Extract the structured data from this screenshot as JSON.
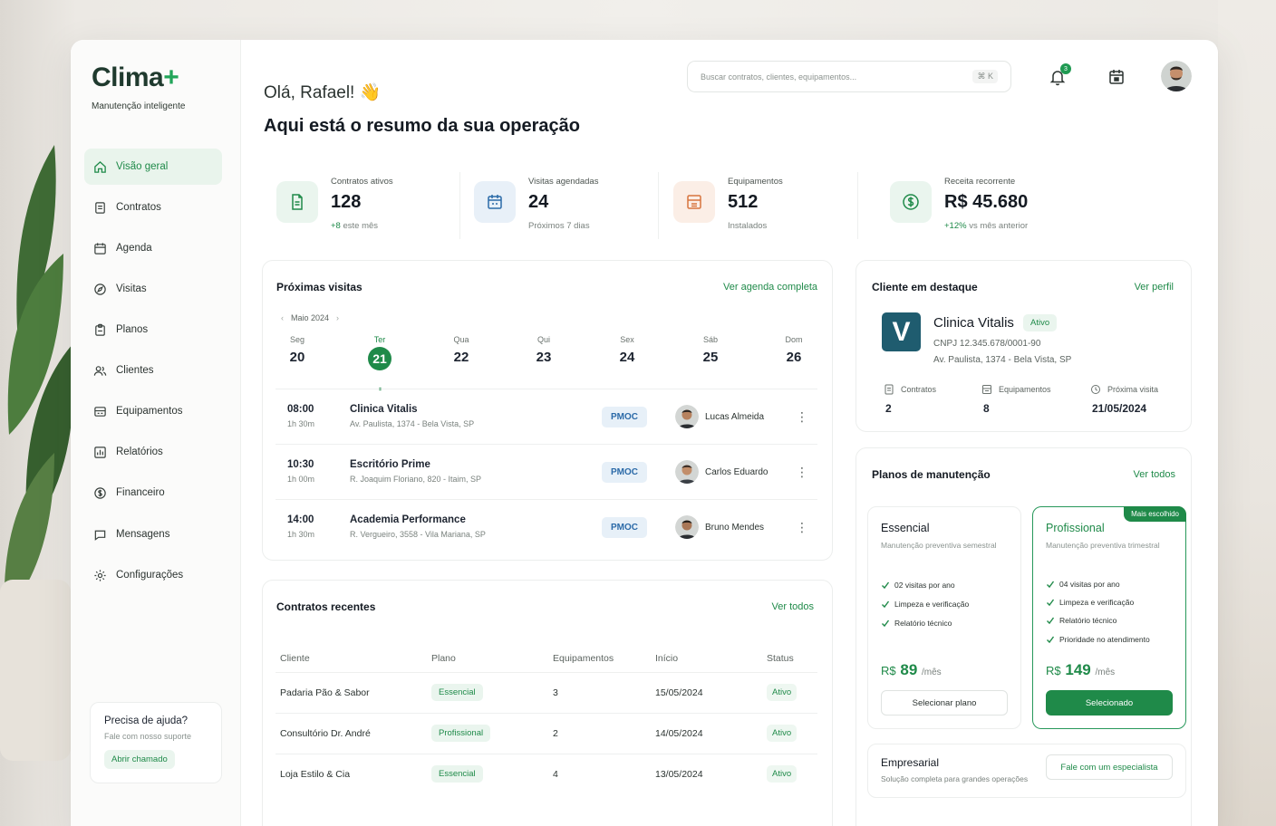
{
  "brand": {
    "name": "Clima",
    "plus": "+",
    "tagline": "Manutenção inteligente"
  },
  "sidebar": {
    "items": [
      {
        "label": "Visão geral",
        "icon": "home-icon",
        "active": true
      },
      {
        "label": "Contratos",
        "icon": "document-icon"
      },
      {
        "label": "Agenda",
        "icon": "calendar-icon"
      },
      {
        "label": "Visitas",
        "icon": "compass-icon"
      },
      {
        "label": "Planos",
        "icon": "clipboard-icon"
      },
      {
        "label": "Clientes",
        "icon": "users-icon"
      },
      {
        "label": "Equipamentos",
        "icon": "equipment-icon"
      },
      {
        "label": "Relatórios",
        "icon": "report-icon"
      },
      {
        "label": "Financeiro",
        "icon": "dollar-icon"
      },
      {
        "label": "Mensagens",
        "icon": "message-icon"
      },
      {
        "label": "Configurações",
        "icon": "gear-icon"
      }
    ],
    "help": {
      "title": "Precisa de ajuda?",
      "subtitle": "Fale com nosso suporte",
      "button": "Abrir chamado"
    }
  },
  "header": {
    "greeting": "Olá, Rafael! 👋",
    "subtitle": "Aqui está o resumo da sua operação",
    "search_placeholder": "Buscar contratos, clientes, equipamentos...",
    "search_shortcut": "⌘ K",
    "notifications": "3"
  },
  "stats": [
    {
      "label": "Contratos ativos",
      "value": "128",
      "sub_highlight": "+8",
      "sub": " este mês"
    },
    {
      "label": "Visitas agendadas",
      "value": "24",
      "sub_highlight": "",
      "sub": "Próximos 7 dias"
    },
    {
      "label": "Equipamentos",
      "value": "512",
      "sub_highlight": "",
      "sub": "Instalados"
    },
    {
      "label": "Receita recorrente",
      "value": "R$ 45.680",
      "sub_highlight": "+12%",
      "sub": " vs mês anterior"
    }
  ],
  "visits": {
    "title": "Próximas visitas",
    "link": "Ver agenda completa",
    "month": "Maio 2024",
    "days": [
      {
        "wd": "Seg",
        "dn": "20"
      },
      {
        "wd": "Ter",
        "dn": "21",
        "today": true
      },
      {
        "wd": "Qua",
        "dn": "22"
      },
      {
        "wd": "Qui",
        "dn": "23"
      },
      {
        "wd": "Sex",
        "dn": "24"
      },
      {
        "wd": "Sáb",
        "dn": "25"
      },
      {
        "wd": "Dom",
        "dn": "26"
      }
    ],
    "rows": [
      {
        "time": "08:00",
        "dur": "1h 30m",
        "client": "Clinica Vitalis",
        "addr": "Av. Paulista, 1374 - Bela Vista, SP",
        "tag": "PMOC",
        "tech": "Lucas Almeida"
      },
      {
        "time": "10:30",
        "dur": "1h 00m",
        "client": "Escritório Prime",
        "addr": "R. Joaquim Floriano, 820 - Itaim, SP",
        "tag": "PMOC",
        "tech": "Carlos Eduardo"
      },
      {
        "time": "14:00",
        "dur": "1h 30m",
        "client": "Academia Performance",
        "addr": "R. Vergueiro, 3558 - Vila Mariana, SP",
        "tag": "PMOC",
        "tech": "Bruno Mendes"
      }
    ]
  },
  "contracts": {
    "title": "Contratos recentes",
    "link": "Ver todos",
    "headers": [
      "Cliente",
      "Plano",
      "Equipamentos",
      "Início",
      "Status"
    ],
    "rows": [
      {
        "client": "Padaria Pão & Sabor",
        "plan": "Essencial",
        "equip": "3",
        "start": "15/05/2024",
        "status": "Ativo"
      },
      {
        "client": "Consultório Dr. André",
        "plan": "Profissional",
        "equip": "2",
        "start": "14/05/2024",
        "status": "Ativo"
      },
      {
        "client": "Loja Estilo & Cia",
        "plan": "Essencial",
        "equip": "4",
        "start": "13/05/2024",
        "status": "Ativo"
      }
    ]
  },
  "featured": {
    "title": "Cliente em destaque",
    "link": "Ver perfil",
    "logo_letter": "V",
    "name": "Clinica Vitalis",
    "badge": "Ativo",
    "cnpj": "CNPJ 12.345.678/0001-90",
    "addr": "Av. Paulista, 1374 - Bela Vista, SP",
    "stats": [
      {
        "label": "Contratos",
        "value": "2"
      },
      {
        "label": "Equipamentos",
        "value": "8"
      },
      {
        "label": "Próxima visita",
        "value": "21/05/2024"
      }
    ]
  },
  "plans": {
    "title": "Planos de manutenção",
    "link": "Ver todos",
    "items": [
      {
        "name": "Essencial",
        "desc": "Manutenção preventiva semestral",
        "features": [
          "02 visitas por ano",
          "Limpeza e verificação",
          "Relatório técnico"
        ],
        "currency": "R$",
        "price": "89",
        "per": "/mês",
        "button": "Selecionar plano"
      },
      {
        "name": "Profissional",
        "desc": "Manutenção preventiva trimestral",
        "ribbon": "Mais escolhido",
        "features": [
          "04 visitas por ano",
          "Limpeza e verificação",
          "Relatório técnico",
          "Prioridade no atendimento"
        ],
        "currency": "R$",
        "price": "149",
        "per": "/mês",
        "button": "Selecionado"
      }
    ],
    "enterprise": {
      "name": "Empresarial",
      "desc": "Solução completa para grandes operações",
      "button": "Fale com um especialista"
    }
  },
  "colors": {
    "accent": "#1f8a49",
    "brand_dark": "#1f3a2e",
    "pmoc_bg": "#e7f0f8",
    "vitalis": "#1f5c6f"
  }
}
